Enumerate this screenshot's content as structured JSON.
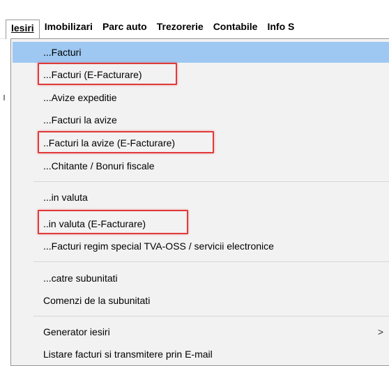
{
  "menubar": {
    "items": [
      {
        "label": "Iesiri",
        "active": true
      },
      {
        "label": "Imobilizari"
      },
      {
        "label": "Parc auto"
      },
      {
        "label": "Trezorerie"
      },
      {
        "label": "Contabile"
      },
      {
        "label": "Info S"
      }
    ]
  },
  "menu": {
    "items": [
      {
        "label": "...Facturi",
        "highlighted": true
      },
      {
        "label": "...Facturi (E-Facturare)",
        "boxed": true
      },
      {
        "label": "...Avize expeditie"
      },
      {
        "label": "...Facturi la avize"
      },
      {
        "label": "..Facturi la avize (E-Facturare)",
        "boxed": true
      },
      {
        "label": "...Chitante / Bonuri fiscale"
      },
      {
        "label": "...in valuta"
      },
      {
        "label": "..in valuta (E-Facturare)",
        "boxed": true
      },
      {
        "label": "...Facturi regim special TVA-OSS / servicii electronice"
      },
      {
        "label": "...catre subunitati"
      },
      {
        "label": "Comenzi de la subunitati"
      },
      {
        "label": "Generator iesiri",
        "submenu_icon": "chevron-right-icon"
      },
      {
        "label": "Listare facturi si transmitere prin E-mail"
      }
    ],
    "submenu_glyph": ">"
  },
  "colors": {
    "highlight": "#9ec8f2",
    "annotation_box": "#e03a3a",
    "menu_background": "#f2f2f2"
  }
}
